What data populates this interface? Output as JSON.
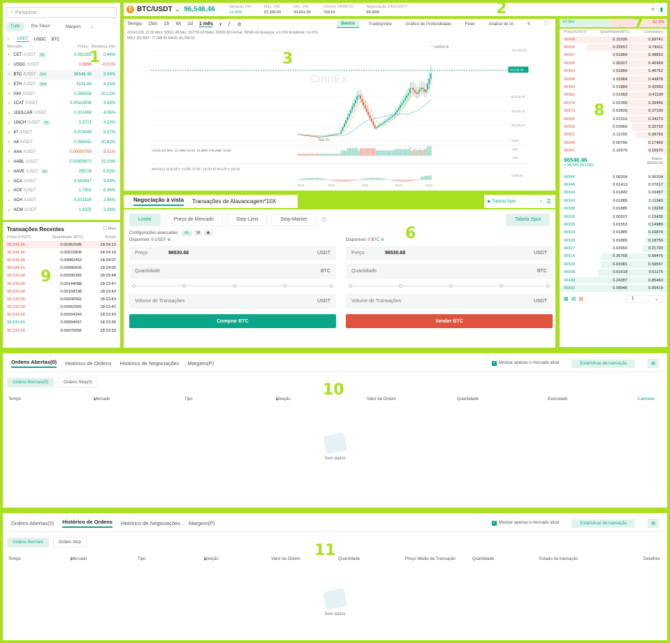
{
  "markets": {
    "search_placeholder": "Pesquisar",
    "filters": [
      "Tudo",
      "Pre-Token",
      "Margem"
    ],
    "quote_tabs": [
      "USDT",
      "USDC",
      "BTC"
    ],
    "col_market": "Mercado:",
    "col_price": "Preço:",
    "col_change": "Mudança 24h:",
    "rows": [
      {
        "base": "CET",
        "quote": "/USDT",
        "lev": "3X",
        "price": "0.092355",
        "change": "0.44%",
        "dir": "up"
      },
      {
        "base": "USDC",
        "quote": "/USDT",
        "lev": "",
        "price": "0.9996",
        "change": "-0.01%",
        "dir": "down"
      },
      {
        "base": "BTC",
        "quote": "/USDT",
        "lev": "10X",
        "price": "96546.46",
        "change": "3.06%",
        "dir": "up"
      },
      {
        "base": "ETH",
        "quote": "/USDT",
        "lev": "10X",
        "price": "3231.84",
        "change": "4.15%",
        "dir": "up"
      },
      {
        "base": "0X0",
        "quote": "/USDT",
        "lev": "",
        "price": "0.289356",
        "change": "20.12%",
        "dir": "up"
      },
      {
        "base": "1CAT",
        "quote": "/USDT",
        "lev": "",
        "price": "0.00115938",
        "change": "4.58%",
        "dir": "up"
      },
      {
        "base": "1DOLLAR",
        "quote": "/USDT",
        "lev": "",
        "price": "0.001458",
        "change": "4.06%",
        "dir": "up"
      },
      {
        "base": "1INCH",
        "quote": "/USDT",
        "lev": "3X",
        "price": "0.3721",
        "change": "4.22%",
        "dir": "up"
      },
      {
        "base": "47",
        "quote": "/USDT",
        "lev": "",
        "price": "0.003049",
        "change": "5.57%",
        "dir": "up"
      },
      {
        "base": "A8",
        "quote": "/USDT",
        "lev": "",
        "price": "0.368432",
        "change": "30.82%",
        "dir": "up"
      },
      {
        "base": "AAA",
        "quote": "/USDT",
        "lev": "",
        "price": "0.00050789",
        "change": "-3.51%",
        "dir": "down"
      },
      {
        "base": "AABL",
        "quote": "/USDT",
        "lev": "",
        "price": "0.00359973",
        "change": "23.10%",
        "dir": "up"
      },
      {
        "base": "AAVE",
        "quote": "/USDT",
        "lev": "5X",
        "price": "295.09",
        "change": "5.93%",
        "dir": "up"
      },
      {
        "base": "ACA",
        "quote": "/USDT",
        "lev": "",
        "price": "0.083947",
        "change": "3.43%",
        "dir": "up"
      },
      {
        "base": "ACE",
        "quote": "/USDT",
        "lev": "",
        "price": "1.7952",
        "change": "6.36%",
        "dir": "up"
      },
      {
        "base": "ACH",
        "quote": "/USDT",
        "lev": "",
        "price": "0.021926",
        "change": "2.96%",
        "dir": "up"
      },
      {
        "base": "ACM",
        "quote": "/USDT",
        "lev": "",
        "price": "1.4325",
        "change": "3.39%",
        "dir": "up"
      }
    ]
  },
  "header": {
    "pair": "BTC/USDT",
    "price": "96,546.46",
    "stats": [
      {
        "label": "Variação 24h",
        "value": "+3.06%",
        "color": "green"
      },
      {
        "label": "Máx. 24h",
        "value": "97,300.00",
        "color": ""
      },
      {
        "label": "Mín. 24h",
        "value": "93,661.90",
        "color": ""
      },
      {
        "label": "Volume 24h(BTC)",
        "value": "728.69",
        "color": ""
      },
      {
        "label": "Negociação 24h(USDT)",
        "value": "69.90M",
        "color": ""
      }
    ]
  },
  "chart": {
    "tabs": [
      "Tempo",
      "15m",
      "1h",
      "4h",
      "1d",
      "1 mês"
    ],
    "active_tab": "1 mês",
    "views": [
      "Básica",
      "TradingView",
      "Gráfico de Profundidade"
    ],
    "extra": [
      "Feed",
      "Análise de IA"
    ],
    "ohlc_line": "2024/12/31 21:00  Abrir: 93601.48  Alto: 102700.00  Baixo: 89309.00  Fechar: 96546.46  Mudança: +3.15%  Amplitude: 14.22%",
    "ma_line": "MA(7,30)  MA7: 77,688.85  MA30: 65,396.05",
    "watermark": "CoinEx",
    "current_price_tag": "96,546.46",
    "high_label": "108350.00",
    "low_label": "3191.51",
    "vol_line": "VOL(5,10)  MA5: 21.005K  MA10: 16.389K  VOLUME: 6.42K",
    "macd_line": "MACD(12,26,9)  DEA: 10,855.79  DIF: 15,021.87  MACD: 4,166.09",
    "y_ticks": [
      "120,000.00",
      "96,546.46",
      "60,000.00",
      "40,000.00",
      "20,000.00",
      "0.000"
    ],
    "vol_ticks": [
      "40K",
      "20K"
    ],
    "macd_ticks": [
      "4,000.00"
    ],
    "x_ticks": [
      "2018",
      "2019",
      "2021",
      "2022",
      "2024"
    ]
  },
  "chart_data": {
    "type": "candlestick",
    "title": "",
    "x": [
      "2018",
      "2019",
      "2021",
      "2022",
      "2024"
    ],
    "ylim": [
      0,
      120000
    ],
    "series": [
      {
        "name": "BTC/USDT",
        "values": [
          3191.51,
          20000,
          60000,
          16000,
          108350
        ]
      }
    ]
  },
  "trade": {
    "tabs": [
      "Negociação à vista",
      "Transações de Alavancagem*10X"
    ],
    "tutorial": "Tutorial Spot",
    "order_types": [
      "Limite",
      "Preço de Mercado",
      "Stop-Limit",
      "Stop-Market"
    ],
    "spot_table": "Tabela Spot",
    "adv_settings": "Configurações avançadas:",
    "adv_value": "AL",
    "available_label": "Disponível:",
    "buy": {
      "available": "0 USDT",
      "price": "96530.68",
      "price_unit": "USDT",
      "qty_unit": "BTC",
      "vol_unit": "USDT",
      "button": "Comprar BTC"
    },
    "sell": {
      "available": "0 BTC",
      "price": "96530.68",
      "price_unit": "USDT",
      "qty_unit": "BTC",
      "vol_unit": "USDT",
      "button": "Vender BTC"
    },
    "price_label": "Preço",
    "qty_label": "Quantidade",
    "vol_label": "Volume de Transações"
  },
  "orderbook": {
    "buy_pct": "47.5%",
    "sell_pct": "52.5%",
    "col_price": "Preço(USDT)",
    "col_qty": "Quantidade(BTC)",
    "col_total": "Cumulativo",
    "asks": [
      {
        "p": "96606",
        "q": "0.15330",
        "t": "0.89741",
        "w": 90
      },
      {
        "p": "96602",
        "q": "0.25557",
        "t": "0.74411",
        "w": 75
      },
      {
        "p": "96597",
        "q": "0.01884",
        "t": "0.48853",
        "w": 50
      },
      {
        "p": "96595",
        "q": "0.00207",
        "t": "0.46969",
        "w": 48
      },
      {
        "p": "96593",
        "q": "0.01884",
        "t": "0.46762",
        "w": 48
      },
      {
        "p": "96588",
        "q": "0.01884",
        "t": "0.44878",
        "w": 46
      },
      {
        "p": "96583",
        "q": "0.01884",
        "t": "0.42993",
        "w": 44
      },
      {
        "p": "96582",
        "q": "0.01653",
        "t": "0.41109",
        "w": 42
      },
      {
        "p": "96578",
        "q": "0.02355",
        "t": "0.39456",
        "w": 40
      },
      {
        "p": "96573",
        "q": "0.02826",
        "t": "0.37100",
        "w": 38
      },
      {
        "p": "96565",
        "q": "0.01553",
        "t": "0.34273",
        "w": 35
      },
      {
        "p": "96555",
        "q": "0.03960",
        "t": "0.32720",
        "w": 33
      },
      {
        "p": "96551",
        "q": "0.11293",
        "t": "0.28760",
        "w": 29
      },
      {
        "p": "96548",
        "q": "0.00796",
        "t": "0.17466",
        "w": 18
      },
      {
        "p": "96547",
        "q": "0.16670",
        "t": "0.16670",
        "w": 17
      }
    ],
    "last_price": "96546.46",
    "last_sub": "≈ 96,543.55  USD",
    "index_label": "Índice:",
    "index_value": "96565.60",
    "bids": [
      {
        "p": "96546",
        "q": "0.06204",
        "t": "0.06204",
        "w": 6
      },
      {
        "p": "96545",
        "q": "0.01413",
        "t": "0.07617",
        "w": 8
      },
      {
        "p": "96544",
        "q": "0.01840",
        "t": "0.09457",
        "w": 10
      },
      {
        "p": "96543",
        "q": "0.01885",
        "t": "0.11343",
        "w": 12
      },
      {
        "p": "96538",
        "q": "0.01885",
        "t": "0.13228",
        "w": 14
      },
      {
        "p": "96536",
        "q": "0.00207",
        "t": "0.13435",
        "w": 14
      },
      {
        "p": "96535",
        "q": "0.01553",
        "t": "0.14989",
        "w": 16
      },
      {
        "p": "96534",
        "q": "0.01885",
        "t": "0.16874",
        "w": 18
      },
      {
        "p": "96529",
        "q": "0.01885",
        "t": "0.18759",
        "w": 20
      },
      {
        "p": "96527",
        "q": "0.02950",
        "t": "0.21709",
        "w": 23
      },
      {
        "p": "96515",
        "q": "0.36766",
        "t": "0.58476",
        "w": 61
      },
      {
        "p": "96509",
        "q": "0.01081",
        "t": "0.59557",
        "w": 62
      },
      {
        "p": "96508",
        "q": "0.01618",
        "t": "0.61175",
        "w": 64
      },
      {
        "p": "96493",
        "q": "0.24287",
        "t": "0.85463",
        "w": 89
      },
      {
        "p": "96491",
        "q": "0.09946",
        "t": "0.95410",
        "w": 99
      }
    ],
    "depth_select": "1"
  },
  "recent": {
    "title": "Transações Recentes",
    "mine": "Meu",
    "col_price": "Preço (USDT)",
    "col_qty": "Quantidade (BTC)",
    "col_time": "Tempo",
    "rows": [
      {
        "p": "96,546.46",
        "q": "0.00362585",
        "t": "18:24:12",
        "dir": "down"
      },
      {
        "p": "96,546.46",
        "q": "0.00222805",
        "t": "18:24:10",
        "dir": "down"
      },
      {
        "p": "96,546.46",
        "q": "0.00082453",
        "t": "18:24:07",
        "dir": "down"
      },
      {
        "p": "96,544.51",
        "q": "0.00090600",
        "t": "18:24:05",
        "dir": "down"
      },
      {
        "p": "96,530.68",
        "q": "0.00330365",
        "t": "18:23:48",
        "dir": "down"
      },
      {
        "p": "96,530.68",
        "q": "0.00144088",
        "t": "18:23:47",
        "dir": "down"
      },
      {
        "p": "96,530.68",
        "q": "0.00158338",
        "t": "18:23:43",
        "dir": "down"
      },
      {
        "p": "96,530.68",
        "q": "0.00200562",
        "t": "18:23:43",
        "dir": "down"
      },
      {
        "p": "96,530.68",
        "q": "0.00262902",
        "t": "18:23:42",
        "dir": "down"
      },
      {
        "p": "96,530.68",
        "q": "0.00294343",
        "t": "18:23:43",
        "dir": "down"
      },
      {
        "p": "96,530.69",
        "q": "0.00094057",
        "t": "18:23:36",
        "dir": "up"
      },
      {
        "p": "96,530.68",
        "q": "0.00076956",
        "t": "18:23:33",
        "dir": "down"
      }
    ]
  },
  "open_orders": {
    "tabs": [
      "Ordens Abertas(0)",
      "Histórico de Ordens",
      "Histórico de Negociações",
      "Margem(P)"
    ],
    "show_current": "Mostrar apenas o mercado atual",
    "stats_btn": "Estatísticas de transação",
    "subtabs": [
      "Ordens Normais(0)",
      "Ordens Stop(0)"
    ],
    "cols": [
      "Tempo",
      "Mercado",
      "Tipo",
      "Direção",
      "Valor da Ordem",
      "Quantidade",
      "Executado",
      "Cancelar"
    ],
    "empty": "Sem dados"
  },
  "history": {
    "tabs": [
      "Ordens Abertas(0)",
      "Histórico de Ordens",
      "Histórico de Negociações",
      "Margem(P)"
    ],
    "show_current": "Mostrar apenas o mercado atual",
    "stats_btn": "Estatísticas de transação",
    "subtabs": [
      "Ordens Normais",
      "Ordem Stop"
    ],
    "cols": [
      "Tempo",
      "Mercado",
      "Tipo",
      "Direção",
      "Valor da Ordem",
      "Quantidade",
      "Preço Médio da Transação",
      "Quantidade",
      "Estado da transação",
      "Detalhes"
    ],
    "empty": "Sem dados"
  },
  "colors": {
    "green": "#0aa888",
    "red": "#e0533f",
    "annotation": "#a8e01e"
  },
  "annotations": [
    "1",
    "2",
    "3",
    "4",
    "5",
    "6",
    "7",
    "8",
    "9",
    "10",
    "11"
  ]
}
